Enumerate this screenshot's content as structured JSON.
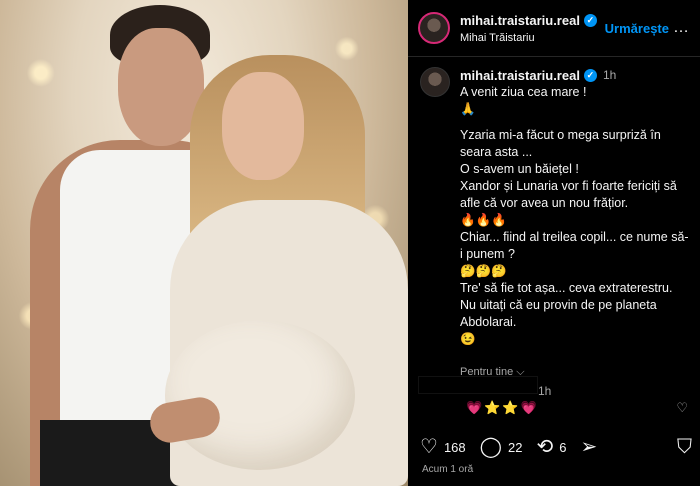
{
  "header": {
    "username": "mihai.traistariu.real",
    "full_name": "Mihai Trăistariu",
    "follow_label": "Urmărește",
    "more_icon": "…"
  },
  "caption": {
    "username": "mihai.traistariu.real",
    "time": "1h",
    "lines": [
      "A venit ziua cea mare !",
      "🙏",
      "Yzaria mi-a făcut o mega surpriză în seara asta ...",
      "O s-avem un băiețel !",
      "Xandor și Lunaria vor fi foarte fericiți să afle că vor avea un nou frățior.",
      "🔥🔥🔥",
      "Chiar... fiind al treilea copil... ce nume să-i punem ?",
      "🤔🤔🤔",
      "Tre' să fie tot așa... ceva extraterestru.",
      "Nu uitați că eu provin de pe planeta Abdolarai.",
      "😉"
    ],
    "see_more": "Pentru tine ⌵"
  },
  "comment": {
    "time": "1h",
    "body": "💗⭐⭐💗"
  },
  "actions": {
    "likes": "168",
    "comments": "22",
    "reposts": "6"
  },
  "posted": "Acum 1 oră",
  "colors": {
    "accent": "#0095f6",
    "background": "#000000"
  }
}
